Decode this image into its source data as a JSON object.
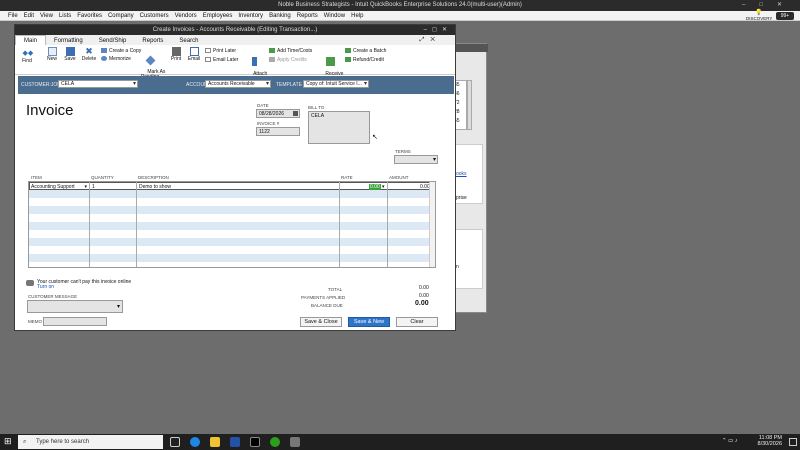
{
  "app": {
    "title": "Noble Business Strategists  - Intuit QuickBooks Enterprise Solutions 24.0(multi-user)(Admin)",
    "menu": [
      "File",
      "Edit",
      "View",
      "Lists",
      "Favorites",
      "Company",
      "Customers",
      "Vendors",
      "Employees",
      "Inventory",
      "Banking",
      "Reports",
      "Window",
      "Help"
    ],
    "discovery": "DISCOVERY HUB",
    "badge": "99+"
  },
  "background_window": {
    "numbers": [
      "35",
      "46",
      "72",
      "28",
      "55"
    ],
    "link_text": "ooks",
    "text2": "prise",
    "text3": "n"
  },
  "invoice_window": {
    "title": "Create Invoices - Accounts Receivable (Editing Transaction...)",
    "tabs": [
      "Main",
      "Formatting",
      "Send/Ship",
      "Reports",
      "Search"
    ],
    "ribbon": {
      "find": "Find",
      "new": "New",
      "save": "Save",
      "delete": "Delete",
      "create_copy": "Create a Copy",
      "memorize": "Memorize",
      "mark_pending": "Mark As\nPending",
      "print": "Print",
      "email": "Email",
      "print_later": "Print Later",
      "email_later": "Email Later",
      "attach_file": "Attach\nFile",
      "add_time": "Add Time/Costs",
      "apply_credits": "Apply Credits",
      "receive_payments": "Receive\nPayments",
      "create_batch": "Create a Batch",
      "refund": "Refund/Credit"
    },
    "header": {
      "customer_label": "CUSTOMER:JOB",
      "customer_value": "CELA",
      "account_label": "ACCOUNT",
      "account_value": "Accounts Receivable",
      "template_label": "TEMPLATE",
      "template_value": "Copy of: Intuit Service I..."
    },
    "form": {
      "heading": "Invoice",
      "date_label": "DATE",
      "date_value": "08/28/2026",
      "invoice_no_label": "INVOICE #",
      "invoice_no_value": "1122",
      "bill_to_label": "BILL TO",
      "bill_to_value": "CELA",
      "terms_label": "TERMS"
    },
    "table": {
      "headers": [
        "ITEM",
        "QUANTITY",
        "DESCRIPTION",
        "RATE",
        "AMOUNT"
      ],
      "rows": [
        {
          "item": "Accounting Support",
          "quantity": "1",
          "description": "Demo to show",
          "rate": "0.00",
          "amount": "0.00"
        }
      ]
    },
    "footer": {
      "payment_note": "Your customer can't pay this invoice online",
      "turn_on": "Turn on",
      "customer_message_label": "CUSTOMER MESSAGE",
      "memo_label": "MEMO",
      "total_label": "TOTAL",
      "total_value": "0.00",
      "payments_label": "PAYMENTS APPLIED",
      "payments_value": "0.00",
      "balance_label": "BALANCE DUE",
      "balance_value": "0.00",
      "save_close": "Save & Close",
      "save_new": "Save & New",
      "clear": "Clear"
    }
  },
  "taskbar": {
    "search_placeholder": "Type here to search",
    "time": "11:08 PM",
    "date": "8/30/2026"
  }
}
